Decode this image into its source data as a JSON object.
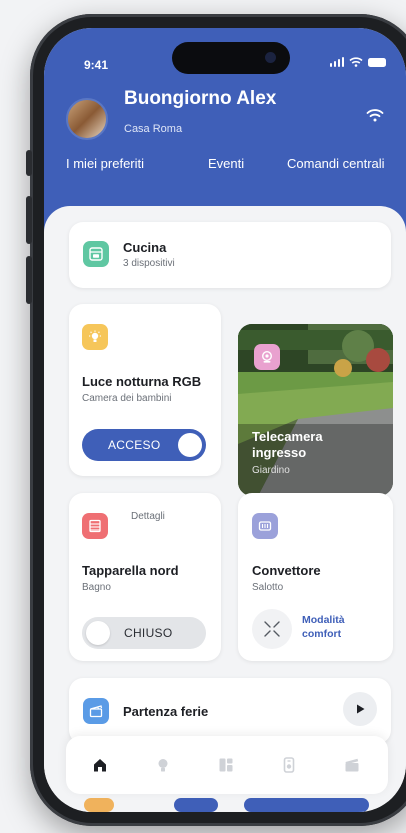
{
  "status_bar": {
    "time": "9:41"
  },
  "header": {
    "greeting": "Buongiorno Alex",
    "home_name": "Casa Roma",
    "tabs": [
      "I miei preferiti",
      "Eventi",
      "Comandi centrali"
    ]
  },
  "rooms": [
    {
      "name": "Cucina",
      "devices": "3 dispositivi",
      "icon": "oven-icon",
      "color": "#5fc7a2"
    }
  ],
  "devices": {
    "light": {
      "name": "Luce notturna RGB",
      "room": "Camera dei bambini",
      "state": "ACCESO",
      "icon": "bulb-icon",
      "color": "#f6c65a"
    },
    "camera": {
      "name": "Telecamera ingresso",
      "room": "Giardino",
      "icon": "camera-icon",
      "color": "#e9a1cf"
    },
    "blind": {
      "name": "Tapparella nord",
      "room": "Bagno",
      "details": "Dettagli",
      "state": "CHIUSO",
      "icon": "blinds-icon",
      "color": "#ef6f73"
    },
    "convector": {
      "name": "Convettore",
      "room": "Salotto",
      "mode": "Modalità comfort",
      "icon": "heater-icon",
      "color": "#9ba1da"
    }
  },
  "scene": {
    "name": "Partenza ferie",
    "icon": "clapper-icon",
    "color": "#5a9be6"
  },
  "bottom_nav": [
    {
      "icon": "home-icon",
      "active": true
    },
    {
      "icon": "bulb-icon",
      "active": false
    },
    {
      "icon": "rooms-icon",
      "active": false
    },
    {
      "icon": "remote-icon",
      "active": false
    },
    {
      "icon": "clapper-icon",
      "active": false
    }
  ],
  "colors": {
    "primary": "#3f5fb8",
    "background": "#f3f4f6"
  }
}
